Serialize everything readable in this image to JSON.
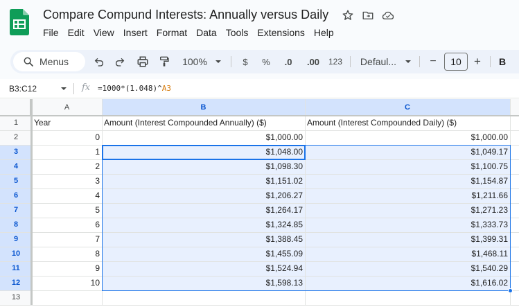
{
  "document": {
    "title": "Compare Compund Interests: Annually versus Daily"
  },
  "menu": [
    "File",
    "Edit",
    "View",
    "Insert",
    "Format",
    "Data",
    "Tools",
    "Extensions",
    "Help"
  ],
  "toolbar": {
    "menus_label": "Menus",
    "zoom": "100%",
    "currency": "$",
    "percent": "%",
    "decrease_decimal": ".0",
    "increase_decimal": ".00",
    "number_format": "123",
    "font": "Defaul...",
    "font_size_minus": "−",
    "font_size": "10",
    "font_size_plus": "+",
    "bold": "B"
  },
  "formula_bar": {
    "name_box": "B3:C12",
    "fx": "fx",
    "formula_text": "=1000*(1.048)^",
    "formula_ref": "A3"
  },
  "columns": [
    "A",
    "B",
    "C"
  ],
  "rows": [
    {
      "num": "1",
      "a": "Year",
      "b": "Amount (Interest Compounded Annually) ($)",
      "c": "Amount (Interest Compounded Daily) ($)"
    },
    {
      "num": "2",
      "a": "0",
      "b": "$1,000.00",
      "c": "$1,000.00"
    },
    {
      "num": "3",
      "a": "1",
      "b": "$1,048.00",
      "c": "$1,049.17"
    },
    {
      "num": "4",
      "a": "2",
      "b": "$1,098.30",
      "c": "$1,100.75"
    },
    {
      "num": "5",
      "a": "3",
      "b": "$1,151.02",
      "c": "$1,154.87"
    },
    {
      "num": "6",
      "a": "4",
      "b": "$1,206.27",
      "c": "$1,211.66"
    },
    {
      "num": "7",
      "a": "5",
      "b": "$1,264.17",
      "c": "$1,271.23"
    },
    {
      "num": "8",
      "a": "6",
      "b": "$1,324.85",
      "c": "$1,333.73"
    },
    {
      "num": "9",
      "a": "7",
      "b": "$1,388.45",
      "c": "$1,399.31"
    },
    {
      "num": "10",
      "a": "8",
      "b": "$1,455.09",
      "c": "$1,468.11"
    },
    {
      "num": "11",
      "a": "9",
      "b": "$1,524.94",
      "c": "$1,540.29"
    },
    {
      "num": "12",
      "a": "10",
      "b": "$1,598.13",
      "c": "$1,616.02"
    },
    {
      "num": "13",
      "a": "",
      "b": "",
      "c": ""
    }
  ],
  "colors": {
    "selection": "#1a73e8",
    "selection_fill": "#e8f0fe",
    "header_selected": "#d3e3fd",
    "sheets_green": "#0f9d58"
  }
}
